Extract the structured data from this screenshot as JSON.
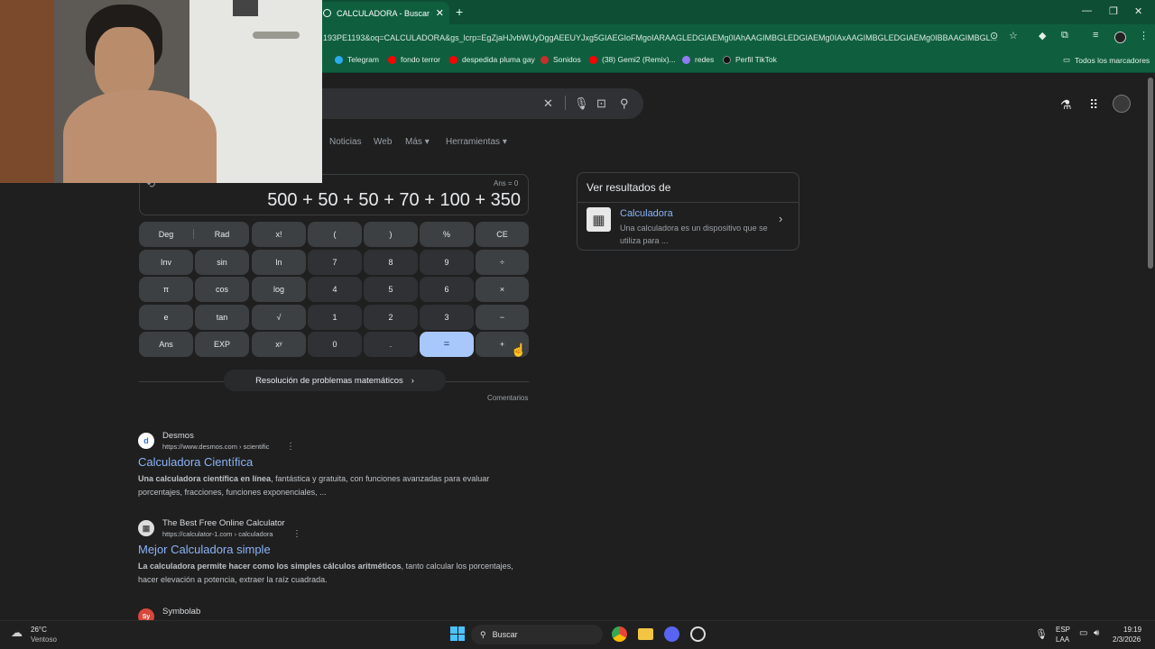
{
  "browser": {
    "tab_title": "CALCULADORA - Buscar con G...",
    "address": "193PE1193&oq=CALCULADORA&gs_lcrp=EgZjaHJvbWUyDggAEEUYJxg5GIAEGIoFMgoIARAAGLEDGIAEMg0IAhAAGIMBGLEDGIAEMg0IAxAAGIMBGLEDGIAEMg0IBBAAGIMBGL...",
    "bookmarks": [
      {
        "label": "Telegram",
        "color": "#2aabee"
      },
      {
        "label": "fondo terror",
        "color": "#ff0000"
      },
      {
        "label": "despedida pluma gay",
        "color": "#ff0000"
      },
      {
        "label": "Sonidos",
        "color": "#c4302b"
      },
      {
        "label": "(38) Gemi2 (Remix)...",
        "color": "#ff0000"
      },
      {
        "label": "redes",
        "color": "#8f7cf0"
      },
      {
        "label": "Perfil TikTok",
        "color": "#111111"
      }
    ],
    "all_bookmarks": "Todos los marcadores"
  },
  "search": {
    "tabs": [
      "Noticias",
      "Web",
      "Más",
      "Herramientas"
    ]
  },
  "calculator": {
    "ans": "Ans = 0",
    "expression": "500 + 50 + 50 + 70 + 100 + 350",
    "keys": [
      [
        "Deg",
        "Rad",
        "x!",
        "(",
        ")",
        "%",
        "CE"
      ],
      [
        "Inv",
        "sin",
        "ln",
        "7",
        "8",
        "9",
        "÷"
      ],
      [
        "π",
        "cos",
        "log",
        "4",
        "5",
        "6",
        "×"
      ],
      [
        "e",
        "tan",
        "√",
        "1",
        "2",
        "3",
        "−"
      ],
      [
        "Ans",
        "EXP",
        "xʸ",
        "0",
        ".",
        "=",
        "+"
      ]
    ],
    "solve_link": "Resolución de problemas matemáticos",
    "feedback": "Comentarios"
  },
  "results": [
    {
      "site": "Desmos",
      "url": "https://www.desmos.com › scientific",
      "title": "Calculadora Científica",
      "snippet_bold": "Una calculadora científica en línea",
      "snippet": ", fantástica y gratuita, con funciones avanzadas para evaluar porcentajes, fracciones, funciones exponenciales, ...",
      "fav": "d",
      "fav_color": "#2f72dc"
    },
    {
      "site": "The Best Free Online Calculator",
      "url": "https://calculator-1.com › calculadora",
      "title": "Mejor Calculadora simple",
      "snippet_bold": "La calculadora permite hacer como los simples cálculos aritméticos",
      "snippet": ", tanto calcular los porcentajes, hacer elevación a potencia, extraer la raíz cuadrada.",
      "fav": "▦",
      "fav_color": "#dddddd"
    },
    {
      "site": "Symbolab",
      "fav": "Sy",
      "fav_color": "#d9473b"
    }
  ],
  "side_panel": {
    "header": "Ver resultados de",
    "title": "Calculadora",
    "desc": "Una calculadora es un dispositivo que se utiliza para ..."
  },
  "taskbar": {
    "temp": "26°C",
    "weather": "Ventoso",
    "search": "Buscar",
    "lang1": "ESP",
    "lang2": "LAA",
    "time": "19:19",
    "date": "2/3/2026"
  }
}
